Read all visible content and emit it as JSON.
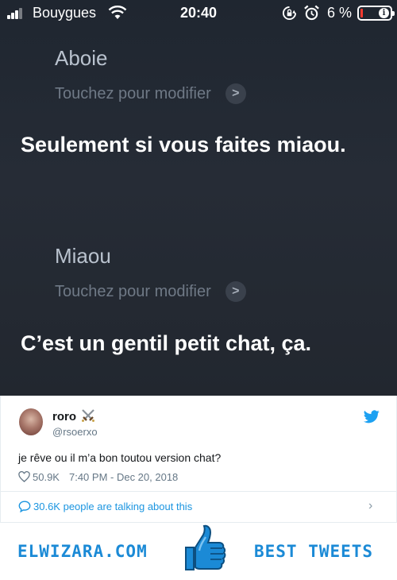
{
  "status_bar": {
    "carrier": "Bouygues",
    "time": "20:40",
    "battery_percent": "6 %",
    "battery_level": 0.06,
    "icons": [
      "signal-bars-icon",
      "wifi-icon",
      "rotation-lock-icon",
      "alarm-icon",
      "battery-icon"
    ]
  },
  "siri": {
    "exchanges": [
      {
        "query": "Aboie",
        "edit_hint": "Touchez pour modifier",
        "answer": "Seulement si vous faites miaou."
      },
      {
        "query": "Miaou",
        "edit_hint": "Touchez pour modifier",
        "answer": "C’est un gentil petit chat, ça."
      }
    ]
  },
  "tweet": {
    "display_name": "roro",
    "handle": "@rsoerxo",
    "text": "je rêve ou il m’a bon toutou version chat?",
    "likes": "50.9K",
    "timestamp": "7:40 PM - Dec 20, 2018",
    "talking": "30.6K people are talking about this",
    "link_color": "#1b95e0"
  },
  "watermark": {
    "left": "ELWIZARA.COM",
    "right": "BEST TWEETS",
    "color": "#1b8ad6"
  }
}
